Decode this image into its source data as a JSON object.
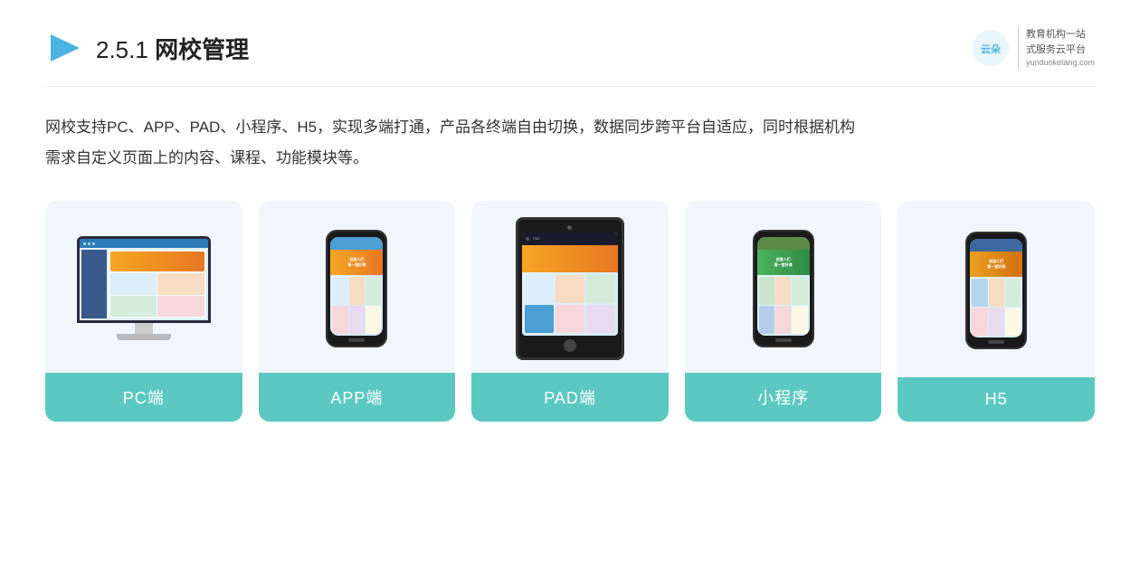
{
  "header": {
    "section_prefix": "2.5.1 ",
    "section_title": "网校管理",
    "logo_url": "yunduoketang.com",
    "logo_tagline1": "教育机构一站",
    "logo_tagline2": "式服务云平台"
  },
  "description": {
    "line1": "网校支持PC、APP、PAD、小程序、H5，实现多端打通，产品各终端自由切换，数据同步跨平台自适应，同时根据机构",
    "line2": "需求自定义页面上的内容、课程、功能模块等。"
  },
  "cards": [
    {
      "id": "pc",
      "label": "PC端"
    },
    {
      "id": "app",
      "label": "APP端"
    },
    {
      "id": "pad",
      "label": "PAD端"
    },
    {
      "id": "miniprogram",
      "label": "小程序"
    },
    {
      "id": "h5",
      "label": "H5"
    }
  ]
}
